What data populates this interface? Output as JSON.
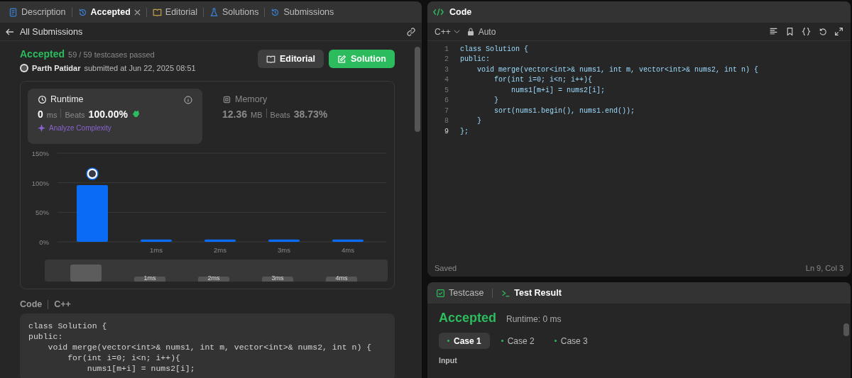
{
  "left_tabs": [
    {
      "label": "Description",
      "selected": false,
      "closable": false
    },
    {
      "label": "Accepted",
      "selected": true,
      "closable": true
    },
    {
      "label": "Editorial",
      "selected": false,
      "closable": false
    },
    {
      "label": "Solutions",
      "selected": false,
      "closable": false
    },
    {
      "label": "Submissions",
      "selected": false,
      "closable": false
    }
  ],
  "back_link": "All Submissions",
  "submission": {
    "status": "Accepted",
    "testcases": "59 / 59 testcases passed",
    "author": "Parth Patidar",
    "submitted": "submitted at Jun 22, 2025 08:51",
    "editorial_button": "Editorial",
    "solution_button": "Solution"
  },
  "stats": [
    {
      "title": "Runtime",
      "selected": true,
      "value": "0",
      "unit": "ms",
      "beats_label": "Beats",
      "beats": "100.00%",
      "link": "Analyze Complexity"
    },
    {
      "title": "Memory",
      "selected": false,
      "value": "12.36",
      "unit": "MB",
      "beats_label": "Beats",
      "beats": "38.73%"
    }
  ],
  "chart_data": {
    "type": "bar",
    "categories": [
      null,
      "1ms",
      "2ms",
      "3ms",
      "4ms"
    ],
    "values": [
      96,
      4,
      4,
      4,
      4
    ],
    "ylim": [
      0,
      150
    ],
    "yticks": [
      {
        "value": 0,
        "label": "0%"
      },
      {
        "value": 50,
        "label": "50%"
      },
      {
        "value": 100,
        "label": "100%"
      },
      {
        "value": 150,
        "label": "150%"
      }
    ]
  },
  "navigator_labels": [
    "1ms",
    "2ms",
    "3ms",
    "4ms"
  ],
  "code_header": {
    "title": "Code",
    "language": "C++"
  },
  "submitted_code": [
    "class Solution {",
    "public:",
    "    void merge(vector<int>& nums1, int m, vector<int>& nums2, int n) {",
    "        for(int i=0; i<n; i++){",
    "            nums1[m+i] = nums2[i];"
  ],
  "editor": {
    "title": "Code",
    "language": "C++",
    "mode": "Auto",
    "status": "Saved",
    "cursor": "Ln 9, Col 3",
    "lines": [
      {
        "number": "1",
        "text": "class Solution {"
      },
      {
        "number": "2",
        "text": "public:"
      },
      {
        "number": "3",
        "text": "    void merge(vector<int>& nums1, int m, vector<int>& nums2, int n) {"
      },
      {
        "number": "4",
        "text": "        for(int i=0; i<n; i++){"
      },
      {
        "number": "5",
        "text": "            nums1[m+i] = nums2[i];"
      },
      {
        "number": "6",
        "text": "        }"
      },
      {
        "number": "7",
        "text": "        sort(nums1.begin(), nums1.end());"
      },
      {
        "number": "8",
        "text": "    }"
      },
      {
        "number": "9",
        "text": "};"
      }
    ]
  },
  "bottom_tabs": [
    {
      "label": "Testcase",
      "selected": false
    },
    {
      "label": "Test Result",
      "selected": true
    }
  ],
  "result": {
    "status": "Accepted",
    "runtime": "Runtime: 0 ms",
    "cases": [
      {
        "label": "Case 1",
        "selected": true
      },
      {
        "label": "Case 2",
        "selected": false
      },
      {
        "label": "Case 3",
        "selected": false
      }
    ],
    "input_label": "Input"
  }
}
